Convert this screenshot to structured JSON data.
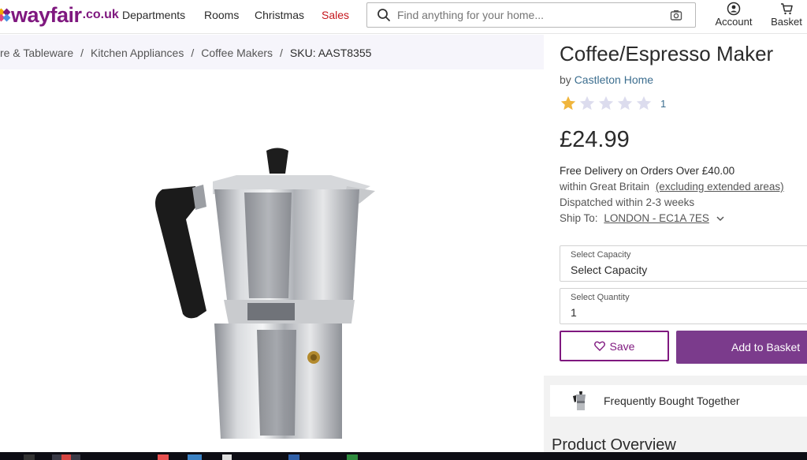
{
  "header": {
    "logo_text": "wayfair",
    "logo_tld": ".co.uk",
    "logo_colors": [
      "#f2a900",
      "#7f187f",
      "#e0457b",
      "#4a90e2"
    ],
    "nav": [
      {
        "label": "Departments"
      },
      {
        "label": "Rooms"
      },
      {
        "label": "Christmas"
      },
      {
        "label": "Sales"
      }
    ],
    "search_placeholder": "Find anything for your home...",
    "account_label": "Account",
    "basket_label": "Basket"
  },
  "breadcrumb": {
    "items": [
      "re & Tableware",
      "Kitchen Appliances",
      "Coffee Makers"
    ],
    "separator": "/",
    "current": "SKU: AAST8355"
  },
  "product": {
    "title": "Coffee/Espresso Maker",
    "by_prefix": "by",
    "brand": "Castleton Home",
    "rating": 1,
    "rating_max": 5,
    "review_count": "1",
    "price": "£24.99",
    "shipping": {
      "line1": "Free Delivery on Orders Over £40.00",
      "line2_a": "within Great Britain",
      "line2_b": "(excluding extended areas)",
      "line3": "Dispatched within 2-3 weeks",
      "ship_to_label": "Ship To:",
      "ship_to_value": "LONDON - EC1A 7ES"
    },
    "capacity": {
      "label": "Select Capacity",
      "value": "Select Capacity"
    },
    "quantity": {
      "label": "Select Quantity",
      "value": "1"
    },
    "save_label": "Save",
    "add_to_basket_label": "Add to Basket",
    "fbt_label": "Frequently Bought Together",
    "overview_label": "Product Overview"
  },
  "colors": {
    "brand_purple": "#7f187f",
    "button_purple": "#7b3b8c",
    "sales_red": "#c5161d",
    "star_gold": "#f0b53c",
    "star_empty": "#dcdcee",
    "link_blue": "#3c6e8f"
  },
  "icons": [
    "search-icon",
    "camera-icon",
    "account-icon",
    "basket-icon",
    "star-icon",
    "heart-icon",
    "chevron-down-icon"
  ]
}
